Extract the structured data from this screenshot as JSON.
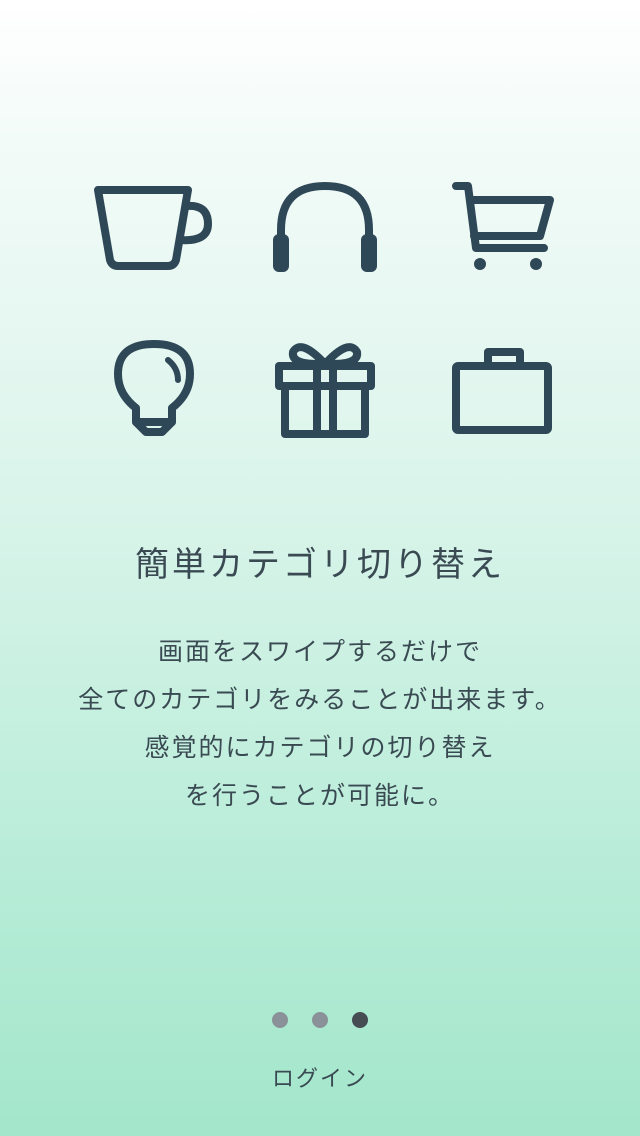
{
  "icons": [
    "coffee-cup-icon",
    "headphones-icon",
    "shopping-cart-icon",
    "light-bulb-icon",
    "gift-icon",
    "briefcase-icon"
  ],
  "colors": {
    "icon": "#2f4858",
    "text": "#3a4a52",
    "gradient_top": "#ffffff",
    "gradient_bottom": "#a3e6cb",
    "dot_inactive": "#8a9198",
    "dot_active": "#454c52"
  },
  "onboarding": {
    "title": "簡単カテゴリ切り替え",
    "description_lines": [
      "画面をスワイプするだけで",
      "全てのカテゴリをみることが出来ます。",
      "感覚的にカテゴリの切り替え",
      "を行うことが可能に。"
    ]
  },
  "pager": {
    "total": 3,
    "current": 3
  },
  "login_label": "ログイン"
}
